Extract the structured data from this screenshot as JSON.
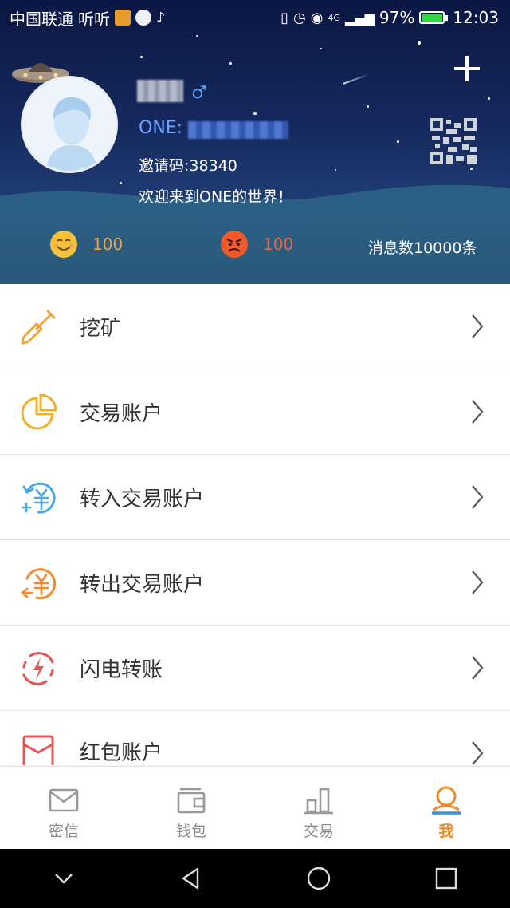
{
  "status_bar": {
    "carrier": "中国联通",
    "app_name": "听听",
    "network": "4G",
    "battery": "97%",
    "time": "12:03"
  },
  "profile": {
    "gender_symbol": "♂",
    "one_label": "ONE:",
    "invite_code": "邀请码:38340",
    "welcome": "欢迎来到ONE的世界！",
    "happy_count": "100",
    "angry_count": "100",
    "message_count": "消息数10000条"
  },
  "menu": {
    "items": [
      {
        "label": "挖矿",
        "icon": "shovel-icon"
      },
      {
        "label": "交易账户",
        "icon": "pie-chart-icon"
      },
      {
        "label": "转入交易账户",
        "icon": "transfer-in-icon"
      },
      {
        "label": "转出交易账户",
        "icon": "transfer-out-icon"
      },
      {
        "label": "闪电转账",
        "icon": "lightning-icon"
      },
      {
        "label": "红包账户",
        "icon": "red-envelope-icon"
      }
    ]
  },
  "bottom_nav": {
    "items": [
      {
        "label": "密信",
        "icon": "mail-icon",
        "active": false
      },
      {
        "label": "钱包",
        "icon": "wallet-icon",
        "active": false
      },
      {
        "label": "交易",
        "icon": "trade-icon",
        "active": false
      },
      {
        "label": "我",
        "icon": "profile-icon",
        "active": true
      }
    ]
  },
  "colors": {
    "accent": "#ef8a2a",
    "header_dark": "#0b1743",
    "one_blue": "#6aa6ff"
  }
}
